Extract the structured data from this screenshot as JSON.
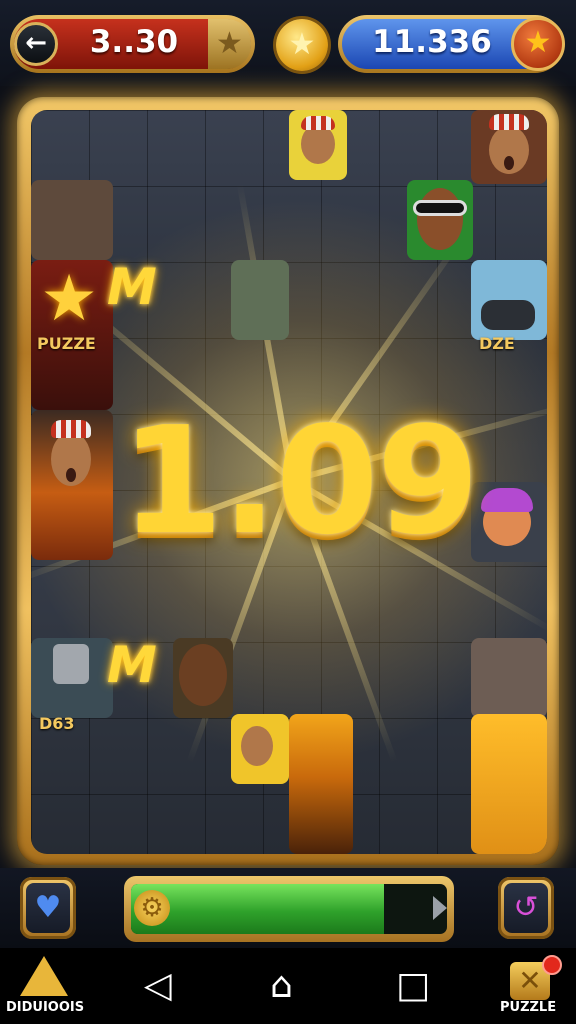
{
  "header": {
    "back_icon": "back-arrow-icon",
    "left_value": "3..30",
    "right_value": "11.336",
    "star_icon": "star-icon"
  },
  "board": {
    "big_number": "1.09",
    "tile_labels": [
      "PUZZE",
      "DZE",
      "D63"
    ],
    "multiplier_tiles": [
      "M",
      "M"
    ]
  },
  "bottom_hud": {
    "progress_fraction": 0.8,
    "left_button_icon": "heart-icon",
    "right_button_icon": "hook-icon",
    "gear_icon": "gear-icon"
  },
  "nav": {
    "left_label": "DIDUIOOIS",
    "right_label": "PUZZLE",
    "back_glyph": "◁",
    "home_glyph": "⌂",
    "recents_glyph": "□"
  },
  "colors": {
    "gold": "#e8b63a",
    "red_pill": "#c6311d",
    "blue_pill": "#1b47b3",
    "progress_green": "#2fa22b"
  }
}
